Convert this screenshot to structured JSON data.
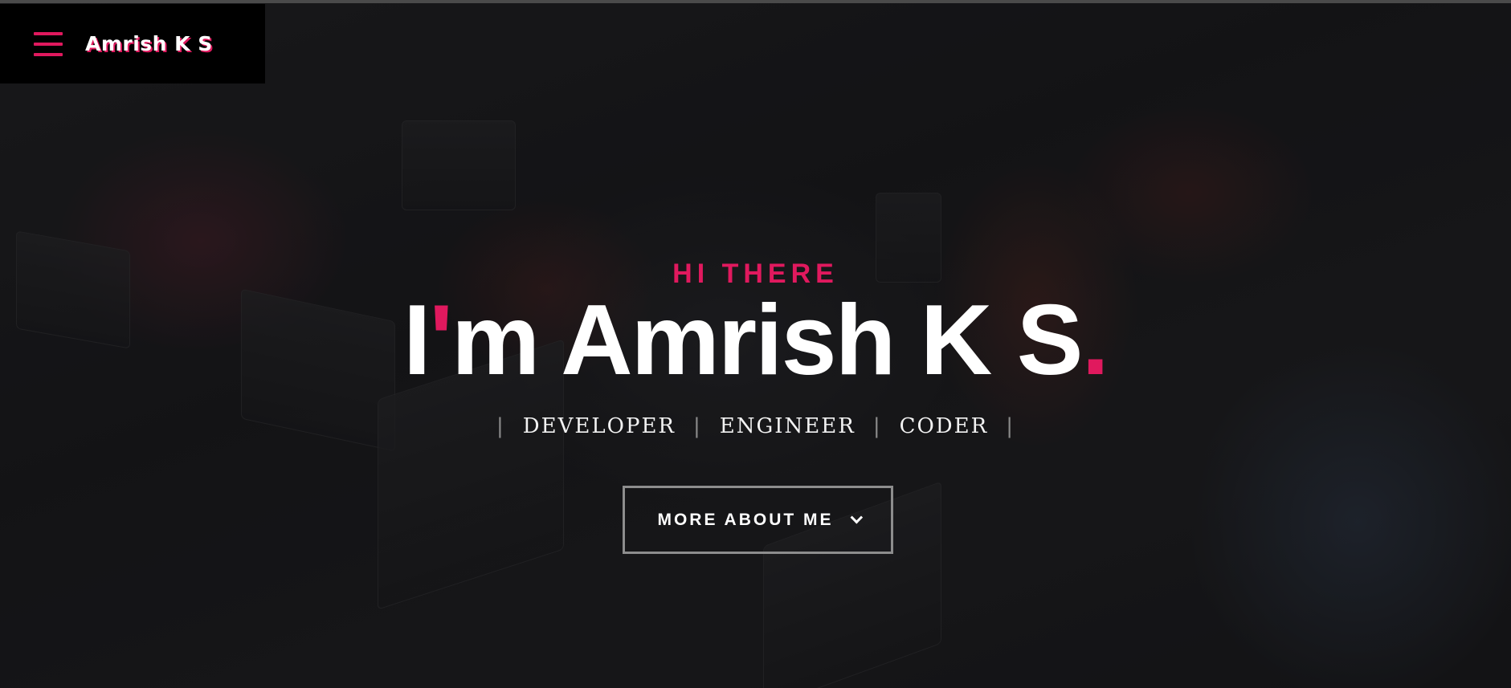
{
  "brand": {
    "name": "Amrish K S",
    "menu_icon": "hamburger-menu-icon",
    "accent_color": "#e0195e"
  },
  "hero": {
    "greeting": "HI THERE",
    "headline_prefix": "I",
    "headline_apostrophe": "'",
    "headline_rest": "m Amrish K S",
    "headline_period": ".",
    "roles": [
      "DEVELOPER",
      "ENGINEER",
      "CODER"
    ],
    "role_separator": "|",
    "cta_label": "MORE ABOUT ME",
    "cta_icon": "chevron-down-icon"
  }
}
